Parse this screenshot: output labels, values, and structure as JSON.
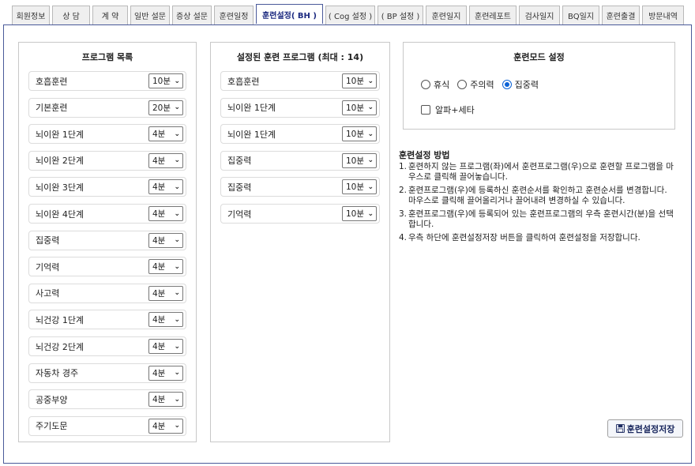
{
  "tabs": [
    {
      "label": "회원정보"
    },
    {
      "label": "상  담"
    },
    {
      "label": "계  약"
    },
    {
      "label": "일반 설문"
    },
    {
      "label": "증상 설문"
    },
    {
      "label": "훈련일정"
    },
    {
      "label": "훈련설정( BH )"
    },
    {
      "label": "( Cog 설정 )"
    },
    {
      "label": "( BP 설정 )"
    },
    {
      "label": "훈련일지"
    },
    {
      "label": "훈련레포트"
    },
    {
      "label": "검사일지"
    },
    {
      "label": "BQ일지"
    },
    {
      "label": "훈련출결"
    },
    {
      "label": "방문내역"
    }
  ],
  "program_list": {
    "title": "프로그램 목록",
    "items": [
      {
        "label": "호흡훈련",
        "value": "10분"
      },
      {
        "label": "기본훈련",
        "value": "20분"
      },
      {
        "label": "뇌이완 1단계",
        "value": "4분"
      },
      {
        "label": "뇌이완 2단계",
        "value": "4분"
      },
      {
        "label": "뇌이완 3단계",
        "value": "4분"
      },
      {
        "label": "뇌이완 4단계",
        "value": "4분"
      },
      {
        "label": "집중력",
        "value": "4분"
      },
      {
        "label": "기억력",
        "value": "4분"
      },
      {
        "label": "사고력",
        "value": "4분"
      },
      {
        "label": "뇌건강 1단계",
        "value": "4분"
      },
      {
        "label": "뇌건강 2단계",
        "value": "4분"
      },
      {
        "label": "자동차 경주",
        "value": "4분"
      },
      {
        "label": "공중부양",
        "value": "4분"
      },
      {
        "label": "주기도문",
        "value": "4분"
      }
    ]
  },
  "configured_list": {
    "title": "설정된 훈련 프로그램 (최대 : 14)",
    "items": [
      {
        "label": "호흡훈련",
        "value": "10분"
      },
      {
        "label": "뇌이완 1단계",
        "value": "10분"
      },
      {
        "label": "뇌이완 1단계",
        "value": "10분"
      },
      {
        "label": "집중력",
        "value": "10분"
      },
      {
        "label": "집중력",
        "value": "10분"
      },
      {
        "label": "기억력",
        "value": "10분"
      }
    ]
  },
  "mode": {
    "title": "훈련모드 설정",
    "options": [
      {
        "label": "휴식",
        "selected": false
      },
      {
        "label": "주의력",
        "selected": false
      },
      {
        "label": "집중력",
        "selected": true
      }
    ],
    "checkbox_label": "알파+세타",
    "checkbox_checked": false
  },
  "help": {
    "title": "훈련설정 방법",
    "steps": [
      {
        "num": "1.",
        "text": "훈련하지 않는 프로그램(좌)에서 훈련프로그램(우)으로 훈련할 프로그램을 마우스로 클릭해 끌어놓습니다."
      },
      {
        "num": "2.",
        "text": "훈련프로그램(우)에 등록하신 훈련순서를 확인하고 훈련순서를 변경합니다. 마우스로 클릭해 끌어올리거나 끌어내려 변경하실 수 있습니다."
      },
      {
        "num": "3.",
        "text": "훈련프로그램(우)에 등록되어 있는 훈련프로그램의 우측 훈련시간(분)을 선택합니다."
      },
      {
        "num": "4.",
        "text": "우측 하단에 훈련설정저장 버튼을 클릭하여 훈련설정을 저장합니다."
      }
    ]
  },
  "save_button": {
    "label": "훈련설정저장",
    "icon": "save-icon"
  },
  "colors": {
    "accent": "#0b62d6",
    "frame": "#4a5a9a"
  }
}
